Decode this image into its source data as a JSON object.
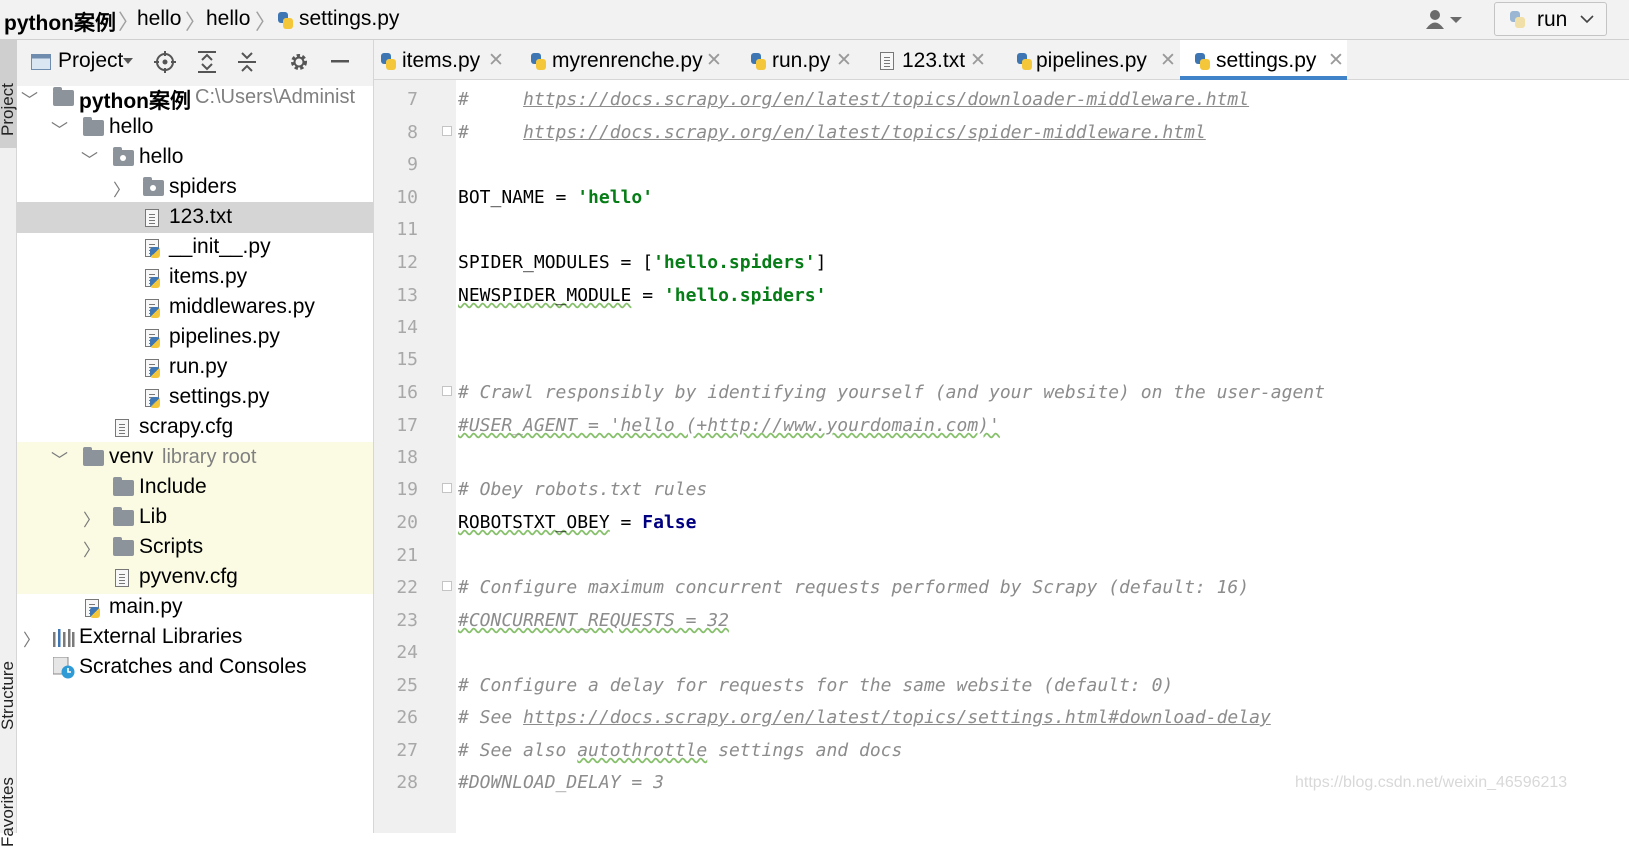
{
  "navbar": {
    "project": "python案例",
    "crumb1": "hello",
    "crumb2": "hello",
    "file": "settings.py",
    "run_config": "run"
  },
  "side_tabs": {
    "project": "Project",
    "structure": "Structure",
    "favorites": "Favorites"
  },
  "project_panel": {
    "title": "Project",
    "tree": [
      {
        "label": "python案例",
        "hint": "C:\\Users\\Administ",
        "icon": "folder-icon"
      },
      {
        "label": "hello",
        "icon": "folder-icon"
      },
      {
        "label": "hello",
        "icon": "package-icon"
      },
      {
        "label": "spiders",
        "icon": "package-icon"
      },
      {
        "label": "123.txt",
        "icon": "text-file-icon"
      },
      {
        "label": "__init__.py",
        "icon": "python-file-icon"
      },
      {
        "label": "items.py",
        "icon": "python-file-icon"
      },
      {
        "label": "middlewares.py",
        "icon": "python-file-icon"
      },
      {
        "label": "pipelines.py",
        "icon": "python-file-icon"
      },
      {
        "label": "run.py",
        "icon": "python-file-icon"
      },
      {
        "label": "settings.py",
        "icon": "python-file-icon"
      },
      {
        "label": "scrapy.cfg",
        "icon": "config-file-icon"
      },
      {
        "label": "venv",
        "hint": "library root",
        "icon": "folder-icon"
      },
      {
        "label": "Include",
        "icon": "folder-icon"
      },
      {
        "label": "Lib",
        "icon": "folder-icon"
      },
      {
        "label": "Scripts",
        "icon": "folder-icon"
      },
      {
        "label": "pyvenv.cfg",
        "icon": "config-file-icon"
      },
      {
        "label": "main.py",
        "icon": "python-file-icon"
      },
      {
        "label": "External Libraries",
        "icon": "library-icon"
      },
      {
        "label": "Scratches and Consoles",
        "icon": "scratches-icon"
      }
    ]
  },
  "tabs": [
    {
      "label": "items.py",
      "icon": "python-file-icon"
    },
    {
      "label": "myrenrenche.py",
      "icon": "python-file-icon"
    },
    {
      "label": "run.py",
      "icon": "python-file-icon"
    },
    {
      "label": "123.txt",
      "icon": "text-file-icon"
    },
    {
      "label": "pipelines.py",
      "icon": "python-file-icon"
    },
    {
      "label": "settings.py",
      "icon": "python-file-icon",
      "active": true
    }
  ],
  "editor": {
    "line_numbers": [
      "7",
      "8",
      "9",
      "10",
      "11",
      "12",
      "13",
      "14",
      "15",
      "16",
      "17",
      "18",
      "19",
      "20",
      "21",
      "22",
      "23",
      "24",
      "25",
      "26",
      "27",
      "28"
    ],
    "lines": {
      "l7_hash": "#     ",
      "l7_url": "https://docs.scrapy.org/en/latest/topics/downloader-middleware.html",
      "l8_hash": "#     ",
      "l8_url": "https://docs.scrapy.org/en/latest/topics/spider-middleware.html",
      "l10_a": "BOT_NAME = ",
      "l10_b": "'hello'",
      "l12_a": "SPIDER_MODULES = [",
      "l12_b": "'hello.spiders'",
      "l12_c": "]",
      "l13_a": "NEWSPIDER_MODULE",
      "l13_b": " = ",
      "l13_c": "'hello.spiders'",
      "l16": "# Crawl responsibly by identifying yourself (and your website) on the user-agent",
      "l17": "#USER_AGENT = 'hello (+http://www.yourdomain.com)'",
      "l19": "# Obey robots.txt rules",
      "l20_a": "ROBOTSTXT_OBEY",
      "l20_b": " = ",
      "l20_c": "False",
      "l22": "# Configure maximum concurrent requests performed by Scrapy (default: 16)",
      "l23": "#CONCURRENT_REQUESTS = 32",
      "l25": "# Configure a delay for requests for the same website (default: 0)",
      "l26_a": "# See ",
      "l26_url": "https://docs.scrapy.org/en/latest/topics/settings.html#download-delay",
      "l27_a": "# See also ",
      "l27_b": "autothrottle",
      "l27_c": " settings and docs",
      "l28": "#DOWNLOAD_DELAY = 3"
    }
  },
  "watermark": "https://blog.csdn.net/weixin_46596213"
}
